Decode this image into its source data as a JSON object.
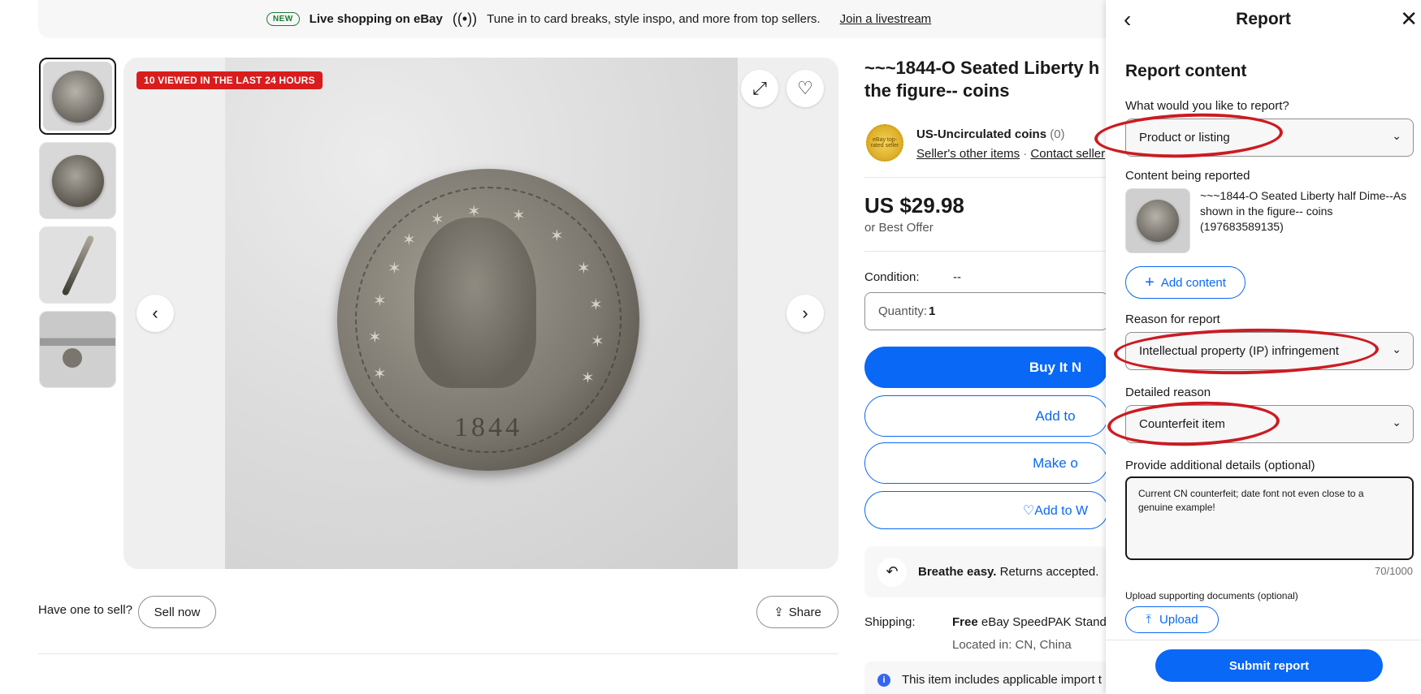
{
  "banner": {
    "badge": "NEW",
    "title": "Live shopping on eBay",
    "text": "Tune in to card breaks, style inspo, and more from top sellers.",
    "link": "Join a livestream"
  },
  "gallery": {
    "viewed_badge": "10 VIEWED IN THE LAST 24 HOURS",
    "coin_date": "1844"
  },
  "below_image": {
    "have_one": "Have one to sell?",
    "sell_now": "Sell now",
    "share": "Share"
  },
  "listing": {
    "title_line1": "~~~1844-O Seated Liberty h",
    "title_line2": "the figure-- coins",
    "seller_name": "US-Uncirculated coins",
    "seller_count": "(0)",
    "seller_badge": "eBay top-rated seller",
    "seller_other_items": "Seller's other items",
    "contact_seller": "Contact seller",
    "price": "US $29.98",
    "best_offer": "or Best Offer",
    "condition_label": "Condition:",
    "condition_value": "--",
    "quantity_label": "Quantity:",
    "quantity_value": "1",
    "buy_it_now": "Buy It N",
    "add_to_cart": "Add to",
    "make_offer": "Make o",
    "add_to_watchlist": "Add to W",
    "returns_bold": "Breathe easy.",
    "returns_text": "Returns accepted.",
    "shipping_label": "Shipping:",
    "shipping_free": "Free",
    "shipping_service": "eBay SpeedPAK Standa",
    "located": "Located in: CN, China",
    "import_text": "This item includes applicable import t"
  },
  "report_panel": {
    "title": "Report",
    "heading": "Report content",
    "q_what": "What would you like to report?",
    "what_value": "Product or listing",
    "content_label": "Content being reported",
    "content_desc": "~~~1844-O Seated Liberty half Dime--As shown in the figure-- coins (197683589135)",
    "add_content": "Add content",
    "reason_label": "Reason for report",
    "reason_value": "Intellectual property (IP) infringement",
    "detailed_label": "Detailed reason",
    "detailed_value": "Counterfeit item",
    "details_label": "Provide additional details (optional)",
    "details_value": "Current CN counterfeit; date font not even close to a genuine example!",
    "counter": "70/1000",
    "upload_label": "Upload supporting documents (optional)",
    "upload": "Upload",
    "submit": "Submit report"
  },
  "colors": {
    "accent_blue": "#0968f6",
    "badge_red": "#d91d1d",
    "annotation_red": "#cc1b22"
  }
}
